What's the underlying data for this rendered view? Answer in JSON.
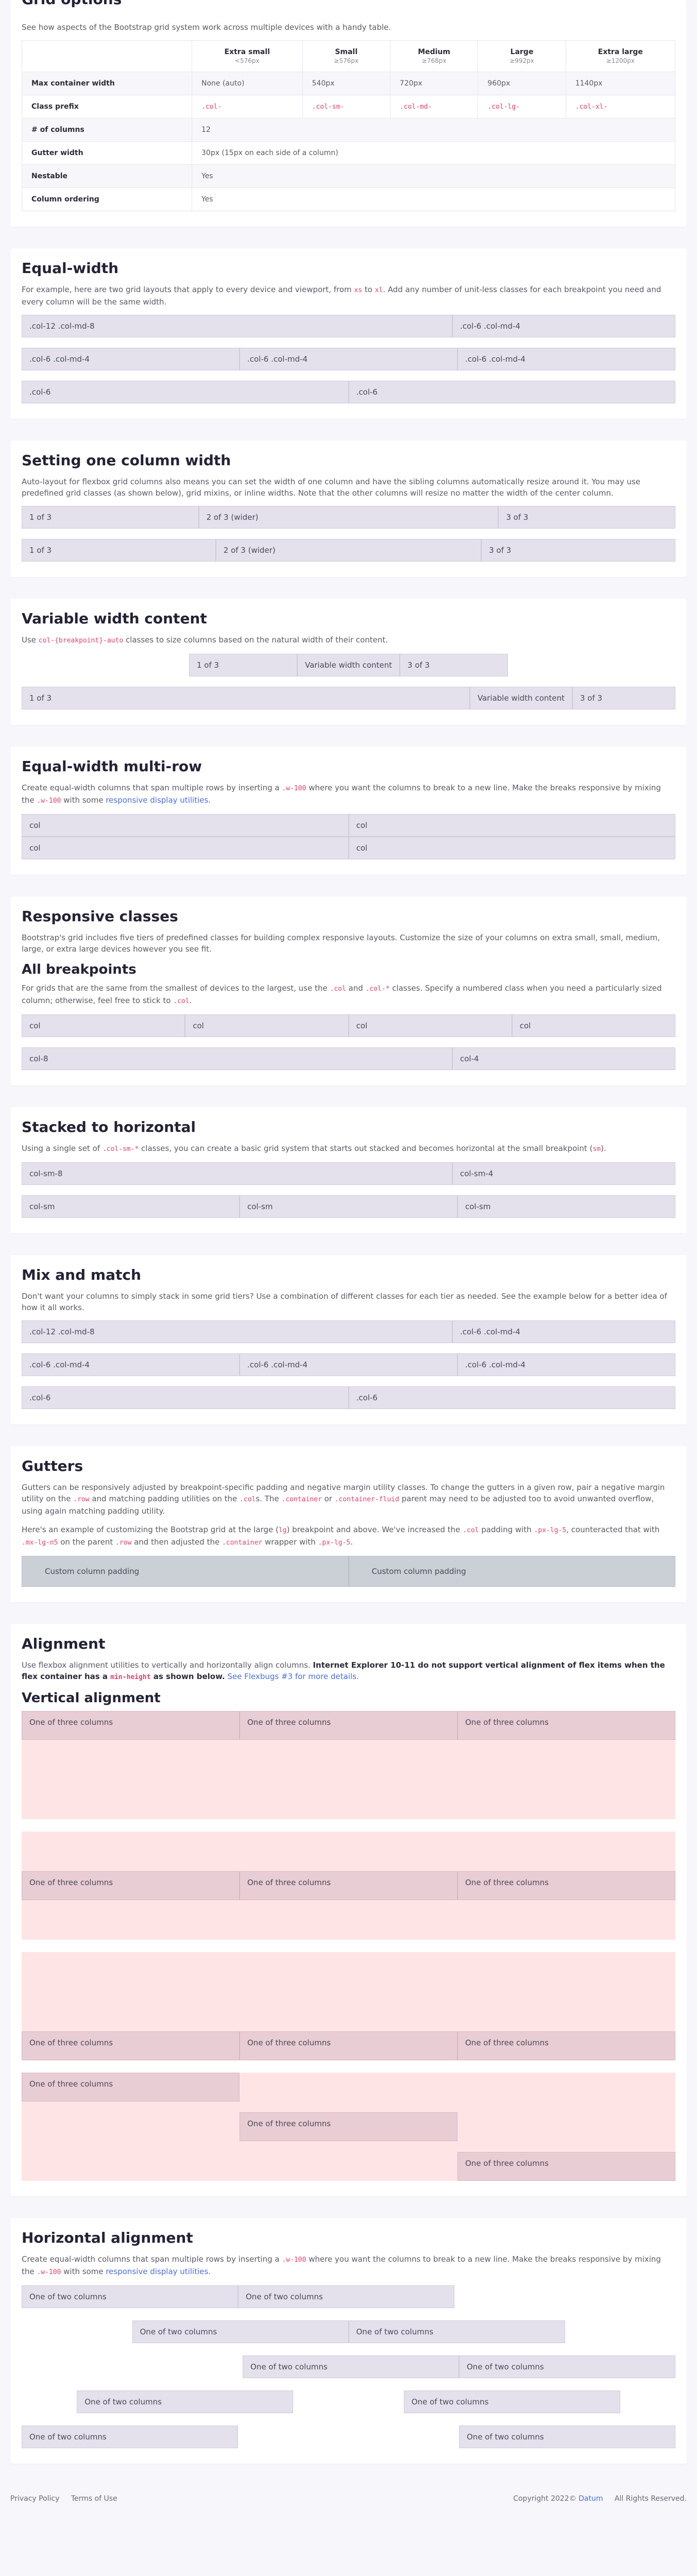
{
  "grid_options": {
    "title": "Grid options",
    "intro": "See how aspects of the Bootstrap grid system work across multiple devices with a handy table.",
    "columns": [
      {
        "name": "Extra small",
        "sub": "<576px"
      },
      {
        "name": "Small",
        "sub": "≥576px"
      },
      {
        "name": "Medium",
        "sub": "≥768px"
      },
      {
        "name": "Large",
        "sub": "≥992px"
      },
      {
        "name": "Extra large",
        "sub": "≥1200px"
      }
    ],
    "rows": [
      {
        "label": "Max container width",
        "cells": [
          "None (auto)",
          "540px",
          "720px",
          "960px",
          "1140px"
        ]
      },
      {
        "label": "Class prefix",
        "code": true,
        "cells": [
          ".col-",
          ".col-sm-",
          ".col-md-",
          ".col-lg-",
          ".col-xl-"
        ]
      },
      {
        "label": "# of columns",
        "span": "12"
      },
      {
        "label": "Gutter width",
        "span": "30px (15px on each side of a column)"
      },
      {
        "label": "Nestable",
        "span": "Yes"
      },
      {
        "label": "Column ordering",
        "span": "Yes"
      }
    ]
  },
  "equal_width": {
    "title": "Equal-width",
    "p_before": "For example, here are two grid layouts that apply to every device and viewport, from ",
    "code1": "xs",
    "p_mid": " to ",
    "code2": "xl",
    "p_after": ". Add any number of unit-less classes for each breakpoint you need and every column will be the same width.",
    "rows": [
      [
        ".col-12 .col-md-8",
        ".col-6 .col-md-4"
      ],
      [
        ".col-6 .col-md-4",
        ".col-6 .col-md-4",
        ".col-6 .col-md-4"
      ],
      [
        ".col-6",
        ".col-6"
      ]
    ]
  },
  "one_column": {
    "title": "Setting one column width",
    "text": "Auto-layout for flexbox grid columns also means you can set the width of one column and have the sibling columns automatically resize around it. You may use predefined grid classes (as shown below), grid mixins, or inline widths. Note that the other columns will resize no matter the width of the center column.",
    "row1": [
      "1 of 3",
      "2 of 3 (wider)",
      "3 of 3"
    ],
    "row2": [
      "1 of 3",
      "2 of 3 (wider)",
      "3 of 3"
    ]
  },
  "variable": {
    "title": "Variable width content",
    "p_before": "Use ",
    "code": "col-{breakpoint}-auto",
    "p_after": " classes to size columns based on the natural width of their content.",
    "row1": [
      "1 of 3",
      "Variable width content",
      "3 of 3"
    ],
    "row2": [
      "1 of 3",
      "Variable width content",
      "3 of 3"
    ]
  },
  "multi_row": {
    "title": "Equal-width multi-row",
    "p_before": "Create equal-width columns that span multiple rows by inserting a ",
    "code": ".w-100",
    "p_mid": " where you want the columns to break to a new line. Make the breaks responsive by mixing the ",
    "code2": ".w-100",
    "p_mid2": " with some ",
    "link": "responsive display utilities",
    "p_after": ".",
    "cells": [
      "col",
      "col",
      "col",
      "col"
    ]
  },
  "responsive": {
    "title": "Responsive classes",
    "text": "Bootstrap's grid includes five tiers of predefined classes for building complex responsive layouts. Customize the size of your columns on extra small, small, medium, large, or extra large devices however you see fit.",
    "sub_title": "All breakpoints",
    "p_before": "For grids that are the same from the smallest of devices to the largest, use the ",
    "code1": ".col",
    "p_mid": " and ",
    "code2": ".col-*",
    "p_mid2": " classes. Specify a numbered class when you need a particularly sized column; otherwise, feel free to stick to ",
    "code3": ".col",
    "p_after": ".",
    "row1": [
      "col",
      "col",
      "col",
      "col"
    ],
    "row2": [
      "col-8",
      "col-4"
    ]
  },
  "stacked": {
    "title": "Stacked to horizontal",
    "p_before": "Using a single set of ",
    "code": ".col-sm-*",
    "p_mid": " classes, you can create a basic grid system that starts out stacked and becomes horizontal at the small breakpoint (",
    "code2": "sm",
    "p_after": ").",
    "row1": [
      "col-sm-8",
      "col-sm-4"
    ],
    "row2": [
      "col-sm",
      "col-sm",
      "col-sm"
    ]
  },
  "mix": {
    "title": "Mix and match",
    "text": "Don't want your columns to simply stack in some grid tiers? Use a combination of different classes for each tier as needed. See the example below for a better idea of how it all works.",
    "rows": [
      [
        ".col-12 .col-md-8",
        ".col-6 .col-md-4"
      ],
      [
        ".col-6 .col-md-4",
        ".col-6 .col-md-4",
        ".col-6 .col-md-4"
      ],
      [
        ".col-6",
        ".col-6"
      ]
    ]
  },
  "gutters": {
    "title": "Gutters",
    "text1_before": "Gutters can be responsively adjusted by breakpoint-specific padding and negative margin utility classes. To change the gutters in a given row, pair a negative margin utility on the ",
    "code1": ".row",
    "text1_mid": " and matching padding utilities on the ",
    "code2": ".col",
    "text1_mid2": "s. The ",
    "code3": ".container",
    "text1_mid3": " or ",
    "code4": ".container-fluid",
    "text1_after": " parent may need to be adjusted too to avoid unwanted overflow, using again matching padding utility.",
    "text2_before": "Here's an example of customizing the Bootstrap grid at the large (",
    "code5": "lg",
    "text2_mid": ") breakpoint and above. We've increased the ",
    "code6": ".col",
    "text2_mid2": " padding with ",
    "code7": ".px-lg-5",
    "text2_mid3": ", counteracted that with ",
    "code8": ".mx-lg-n5",
    "text2_mid4": " on the parent ",
    "code9": ".row",
    "text2_mid5": " and then adjusted the ",
    "code10": ".container",
    "text2_mid6": " wrapper with ",
    "code11": ".px-lg-5",
    "text2_after": ".",
    "cells": [
      "Custom column padding",
      "Custom column padding"
    ]
  },
  "alignment": {
    "title": "Alignment",
    "p_before": "Use flexbox alignment utilities to vertically and horizontally align columns. ",
    "bold": "Internet Explorer 10-11 do not support vertical alignment of flex items when the flex container has a ",
    "code": "min-height",
    "bold_after": " as shown below.",
    "link": " See Flexbugs #3 for more details.",
    "sub_title": "Vertical alignment",
    "cell": "One of three columns"
  },
  "horizontal": {
    "title": "Horizontal alignment",
    "p_before": "Create equal-width columns that span multiple rows by inserting a ",
    "code": ".w-100",
    "p_mid": " where you want the columns to break to a new line. Make the breaks responsive by mixing the ",
    "code2": ".w-100",
    "p_mid2": " with some ",
    "link": "responsive display utilities",
    "p_after": ".",
    "cell": "One of two columns"
  },
  "footer": {
    "privacy": "Privacy Policy",
    "terms": "Terms of Use",
    "copy_before": "Copyright 2022© ",
    "brand": "Datum",
    "copy_after": " All Rights Reserved."
  }
}
